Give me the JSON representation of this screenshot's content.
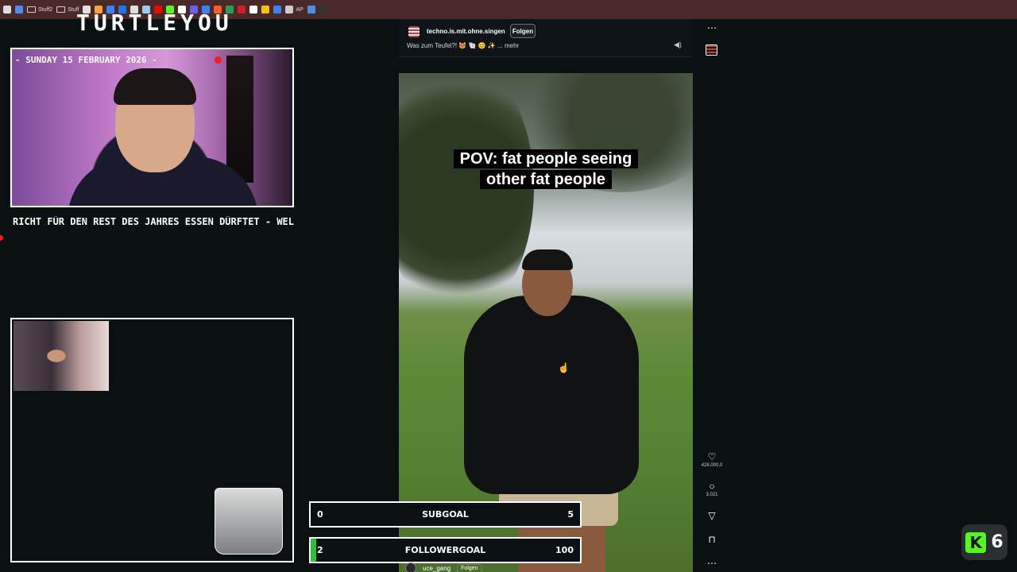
{
  "bookmarks": [
    {
      "icon": "chrome-icon",
      "color": "#dddddd",
      "label": ""
    },
    {
      "icon": "drive-icon",
      "color": "#4a8ef0",
      "label": ""
    },
    {
      "icon": "folder-icon",
      "color": "",
      "label": "Stuff2"
    },
    {
      "icon": "folder-icon",
      "color": "",
      "label": "Stuff"
    },
    {
      "icon": "site-icon",
      "color": "#e0e0e0",
      "label": ""
    },
    {
      "icon": "site-icon",
      "color": "#f2a33a",
      "label": ""
    },
    {
      "icon": "site-icon",
      "color": "#3b82f6",
      "label": ""
    },
    {
      "icon": "facebook-icon",
      "color": "#1877f2",
      "label": ""
    },
    {
      "icon": "site-icon",
      "color": "#e0e0e0",
      "label": ""
    },
    {
      "icon": "site-icon",
      "color": "#9ccaf0",
      "label": ""
    },
    {
      "icon": "youtube-icon",
      "color": "#ff0000",
      "label": ""
    },
    {
      "icon": "kick-icon",
      "color": "#53fc18",
      "label": ""
    },
    {
      "icon": "site-icon",
      "color": "#ffffff",
      "label": ""
    },
    {
      "icon": "site-icon",
      "color": "#6a5cff",
      "label": ""
    },
    {
      "icon": "site-icon",
      "color": "#3b82f6",
      "label": ""
    },
    {
      "icon": "site-icon",
      "color": "#ff5a1f",
      "label": ""
    },
    {
      "icon": "site-icon",
      "color": "#2a9d52",
      "label": ""
    },
    {
      "icon": "site-icon",
      "color": "#d02020",
      "label": ""
    },
    {
      "icon": "site-icon",
      "color": "#ffffff",
      "label": ""
    },
    {
      "icon": "site-icon",
      "color": "#f5c400",
      "label": ""
    },
    {
      "icon": "site-icon",
      "color": "#3b82f6",
      "label": ""
    },
    {
      "icon": "globe-icon",
      "color": "#cccccc",
      "label": "AP"
    },
    {
      "icon": "site-icon",
      "color": "#4a8ef0",
      "label": ""
    },
    {
      "icon": "site-icon",
      "color": "#333333",
      "label": ""
    }
  ],
  "brand": {
    "name": "TURTLEYOU"
  },
  "webcam": {
    "date": "- SUNDAY 15 FEBRUARY 2026 -"
  },
  "ticker": {
    "text": "RICHT FÜR DEN REST DES JAHRES ESSEN DÜRFTET - WELCHES WÄRE"
  },
  "tiktok": {
    "username": "techno.is.mit.ohne.singen",
    "follow": "Folgen",
    "caption": "Was zum Teufel?! 😻 🐚 😊 ✨ ... mehr",
    "video_caption_line1": "POV: fat people seeing",
    "video_caption_line2": "other fat people",
    "likes": "428.000,0",
    "comments": "3.021",
    "more": "⋯"
  },
  "goals": {
    "sub": {
      "current": "0",
      "label": "SUBGOAL",
      "target": "5",
      "progress": 0
    },
    "follow": {
      "current": "2",
      "label": "FOLLOWERGOAL",
      "target": "100",
      "progress": 0.02
    }
  },
  "overlay_user": {
    "name": "uce_gang",
    "follow": "Folgen"
  },
  "kick_badge": {
    "count": "6",
    "letter": "K",
    "color": "#53fc18"
  }
}
